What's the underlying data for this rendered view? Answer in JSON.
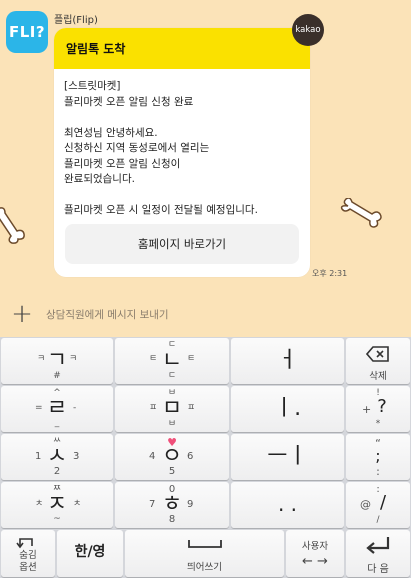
{
  "chat": {
    "sender": "플립(Flip)",
    "avatar_text": "FLI?",
    "bubble_title": "알림톡 도착",
    "message_lines": [
      "[스트릿마켓]",
      "플리마켓 오픈 알림 신청 완료",
      "",
      "최연성님 안녕하세요.",
      "신청하신 지역 동성로에서 열리는",
      "플리마켓 오픈 알림 신청이",
      "완료되었습니다.",
      "",
      "플리마켓 오픈 시 일정이 전달될 예정입니다."
    ],
    "button_label": "홈페이지 바로가기",
    "badge": "kakao",
    "time": "오후 2:31"
  },
  "input": {
    "placeholder": "상담직원에게 메시지 보내기",
    "plus_icon": "+"
  },
  "keyboard": {
    "row1": [
      {
        "main": "ㄱ",
        "top_left": "ㅋ",
        "top_right": "ㅋ",
        "bottom": "#"
      },
      {
        "main": "ㄴ",
        "top_left": "ㅌ",
        "top_right": "ㅌ",
        "top": "ㄷ",
        "bottom": "ㄷ"
      },
      {
        "main": "ㅓ"
      },
      {
        "icon": "backspace-icon",
        "label": "삭제"
      }
    ],
    "row2": [
      {
        "main": "ㄹ",
        "top": "^",
        "left": "=",
        "right": "-",
        "bottom": "_"
      },
      {
        "main": "ㅁ",
        "top": "ㅂ",
        "left": "ㅍ",
        "right": "ㅍ",
        "bottom": "ㅂ"
      },
      {
        "main": "ㅣ."
      },
      {
        "main": "?",
        "top": "!",
        "left": "+",
        "bottom": "*"
      }
    ],
    "row3": [
      {
        "main": "ㅅ",
        "top": "ㅆ",
        "left": "1",
        "right": "3",
        "bottom": "2"
      },
      {
        "main": "ㅇ",
        "top": "♥",
        "left": "4",
        "right": "6",
        "bottom": "5"
      },
      {
        "main": "ㅡㅣ"
      },
      {
        "main": ";",
        "top": "“",
        "bottom": ":"
      }
    ],
    "row4": [
      {
        "main": "ㅈ",
        "top": "ㅉ",
        "left": "ㅊ",
        "right": "ㅊ",
        "bottom": "~"
      },
      {
        "main": "ㅎ",
        "top": "0",
        "left": "7",
        "right": "9",
        "bottom": "8"
      },
      {
        "main": ". ."
      },
      {
        "main": "/",
        "top": ":",
        "left": "@",
        "bottom": "/"
      }
    ],
    "row5": {
      "hide_label_1": "숨김",
      "hide_label_2": "옵션",
      "lang_label": "한/영",
      "space_label": "띄어쓰기",
      "user_label": "사용자",
      "arrows": "← →",
      "enter_label": "다 음"
    }
  }
}
